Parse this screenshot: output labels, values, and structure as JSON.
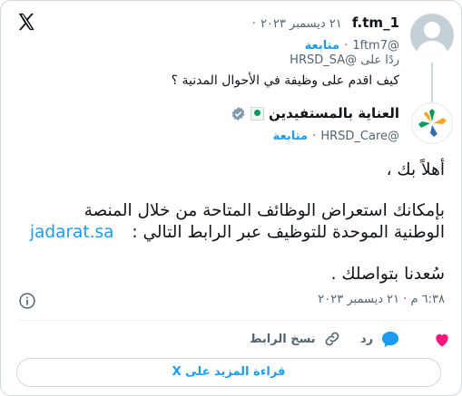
{
  "reply": {
    "display_name": "1_f.tm",
    "date": "٢١ ديسمبر ٢٠٢٣",
    "separator": "·",
    "handle": "@1ftm7",
    "follow_label": "متابعة",
    "replying_to_prefix": "ردًا على",
    "replying_to_handle": "@HRSD_SA",
    "text": "كيف اقدم على وظيفة في الأحوال المدنية ؟"
  },
  "main": {
    "display_name": "العناية بالمستفيدين",
    "handle": "@HRSD_Care",
    "separator": "·",
    "follow_label": "متابعة",
    "greeting": "أهلاً بك ،",
    "body_line1": "بإمكانك استعراض الوظائف المتاحة من خلال المنصة",
    "body_line2_text": "الوطنية الموحدة للتوظيف عبر الرابط التالي :",
    "body_link": "jadarat.sa",
    "closing": "سُعدنا بتواصلك .",
    "timestamp": "٦:٣٨ م · ٢١ ديسمبر ٢٠٢٣"
  },
  "actions": {
    "like_label": "",
    "reply_label": "رد",
    "copy_link_label": "نسخ الرابط"
  },
  "read_more_label": "قراءة المزيد على X",
  "colors": {
    "accent": "#1d9bf0",
    "like": "#f91880",
    "muted": "#536471",
    "border": "#cfd9de"
  },
  "icons": [
    "x-logo-icon",
    "verified-icon",
    "info-icon",
    "heart-icon",
    "speech-bubble-icon",
    "link-icon",
    "flag-emoji-icon",
    "hrsd-logo-icon"
  ]
}
